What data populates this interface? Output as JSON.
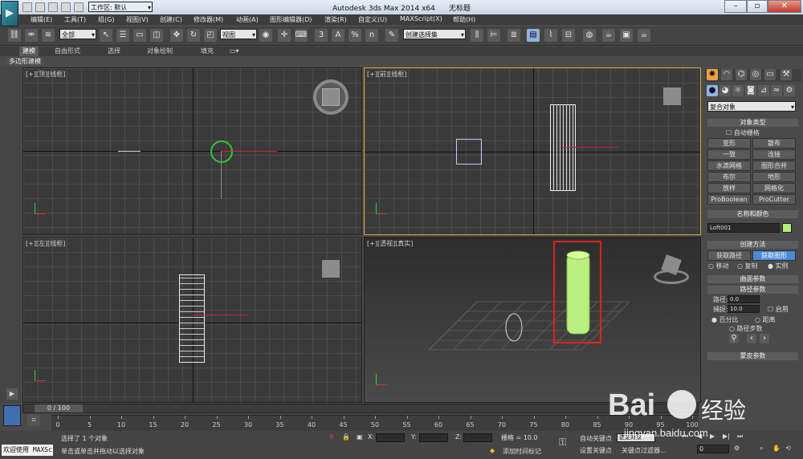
{
  "window": {
    "title": "Autodesk 3ds Max  2014 x64",
    "doc": "无标题",
    "workspace": "工作区: 默认",
    "app_icon": "3ds-max-logo-icon"
  },
  "menu": [
    "编辑(E)",
    "工具(T)",
    "组(G)",
    "视图(V)",
    "创建(C)",
    "修改器(M)",
    "动画(A)",
    "图形编辑器(D)",
    "渲染(R)",
    "自定义(U)",
    "MAXScript(X)",
    "帮助(H)"
  ],
  "toolbar": {
    "selection_filter": "全部",
    "ref_coord": "视图",
    "named_sel": "创建选择集",
    "snap_label": "3",
    "angle_snap_label": "A",
    "percent_snap_label": "%",
    "spinner_snap_label": "n"
  },
  "ribbon": {
    "tabs": [
      "建模",
      "自由形式",
      "选择",
      "对象绘制",
      "填充"
    ],
    "sub": "多边形建模"
  },
  "viewports": {
    "top": "[+][顶][线框]",
    "front": "[+][前][线框]",
    "left": "[+][左][线框]",
    "persp": "[+][透视][真实]"
  },
  "command_panel": {
    "category": "复合对象",
    "object_type_header": "对象类型",
    "auto_grid": "自动栅格",
    "buttons": [
      "变形",
      "散布",
      "一致",
      "连接",
      "水滴网格",
      "图形合并",
      "布尔",
      "地形",
      "放样",
      "网格化",
      "ProBoolean",
      "ProCutter"
    ],
    "name_color_header": "名称和颜色",
    "object_name": "Loft001",
    "object_color": "#b4f07a",
    "creation_method_header": "创建方法",
    "get_path": "获取路径",
    "get_shape": "获取图形",
    "move": "移动",
    "copy": "复制",
    "instance": "实例",
    "surface_params": "曲面参数",
    "path_params": "路径参数",
    "path_label": "路径:",
    "path_value": "0.0",
    "snap_label": "捕捉:",
    "snap_value": "10.0",
    "enable": "启用",
    "percent": "百分比",
    "distance": "距离",
    "path_steps": "路径步数",
    "skin_params": "蒙皮参数"
  },
  "timeline": {
    "frame": "0 / 100",
    "ticks": [
      0,
      5,
      10,
      15,
      20,
      25,
      30,
      35,
      40,
      45,
      50,
      55,
      60,
      65,
      70,
      75,
      80,
      85,
      90,
      95,
      100
    ]
  },
  "status": {
    "welcome": "欢迎使用 MAXSc",
    "selected": "选择了 1 个对象",
    "hint": "单击或单击并拖动以选择对象",
    "x_label": "X:",
    "y_label": "Y:",
    "z_label": "Z:",
    "grid": "栅格 = 10.0",
    "add_time_tag": "添加时间标记",
    "auto_key": "自动关键点",
    "set_key": "设置关键点",
    "selected_obj": "选定对象",
    "key_filters": "关键点过滤器...",
    "frame_value": "0"
  },
  "watermark": {
    "brand": "Bai",
    "brand2": "经验",
    "url": "jingyan.baidu.com"
  }
}
